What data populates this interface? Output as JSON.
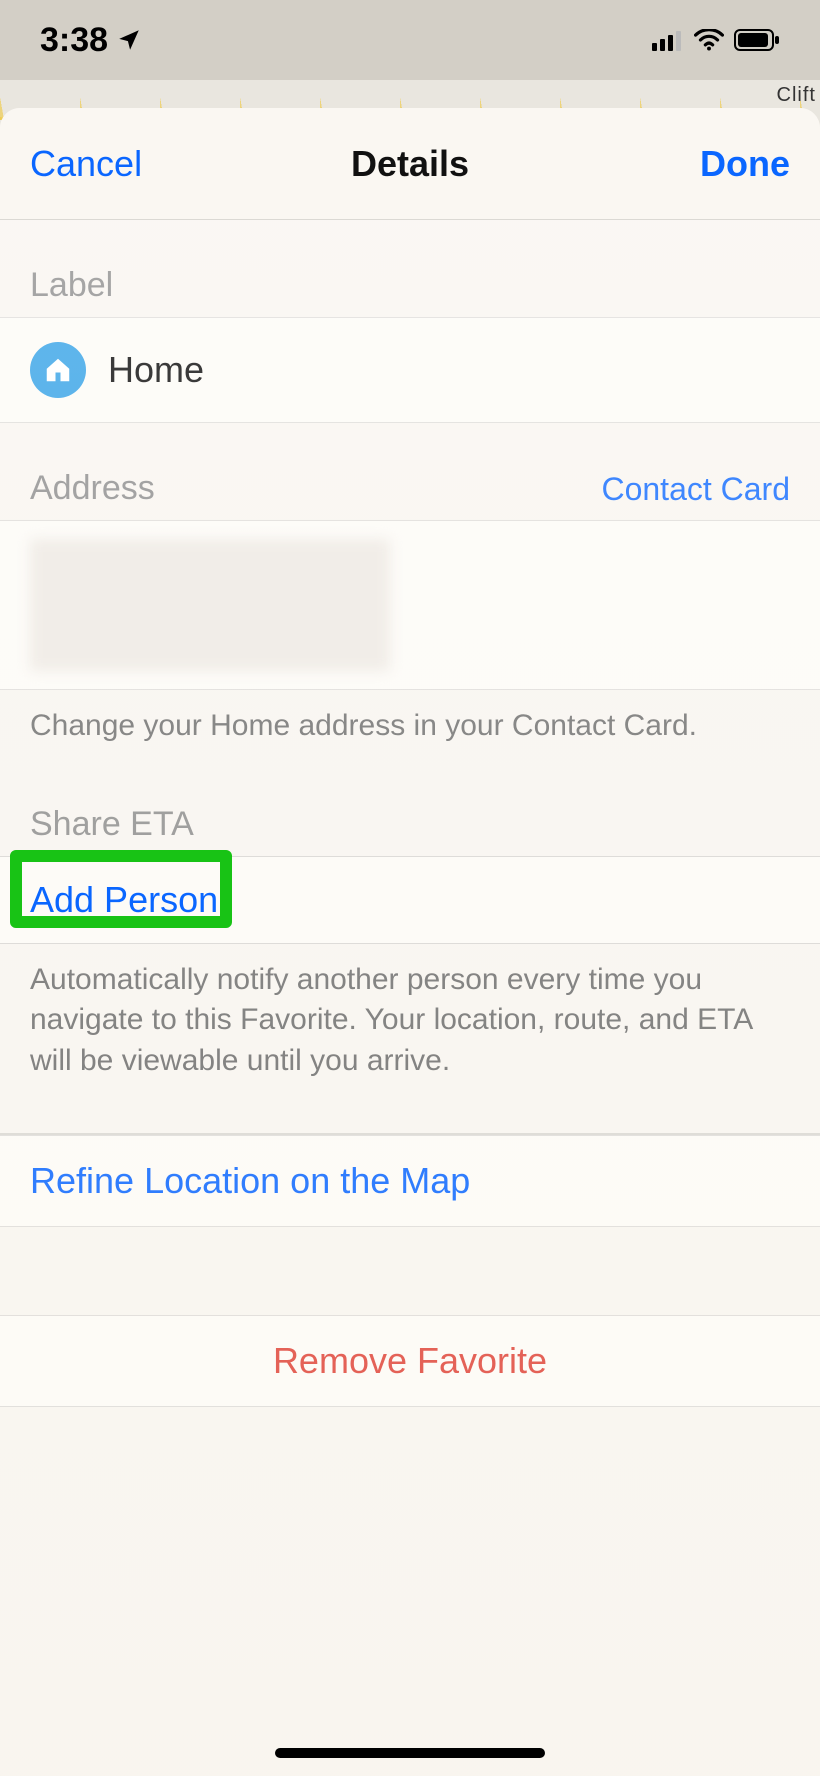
{
  "status": {
    "time": "3:38",
    "location_icon": "location-arrow-icon",
    "signal_icon": "cellular-signal-icon",
    "wifi_icon": "wifi-icon",
    "battery_icon": "battery-icon"
  },
  "map": {
    "visible_label": "Clift"
  },
  "nav": {
    "cancel": "Cancel",
    "title": "Details",
    "done": "Done"
  },
  "sections": {
    "label": {
      "header": "Label",
      "value": "Home",
      "icon": "home-icon"
    },
    "address": {
      "header": "Address",
      "contact_card_link": "Contact Card",
      "note": "Change your Home address in your Contact Card."
    },
    "share_eta": {
      "header": "Share ETA",
      "add_person": "Add Person",
      "note": "Automatically notify another person every time you navigate to this Favorite. Your location, route, and ETA will be viewable until you arrive."
    },
    "refine": {
      "label": "Refine Location on the Map"
    },
    "remove": {
      "label": "Remove Favorite"
    }
  },
  "annotation": {
    "highlight_target": "add-person-button",
    "highlight_color": "#18c315"
  }
}
